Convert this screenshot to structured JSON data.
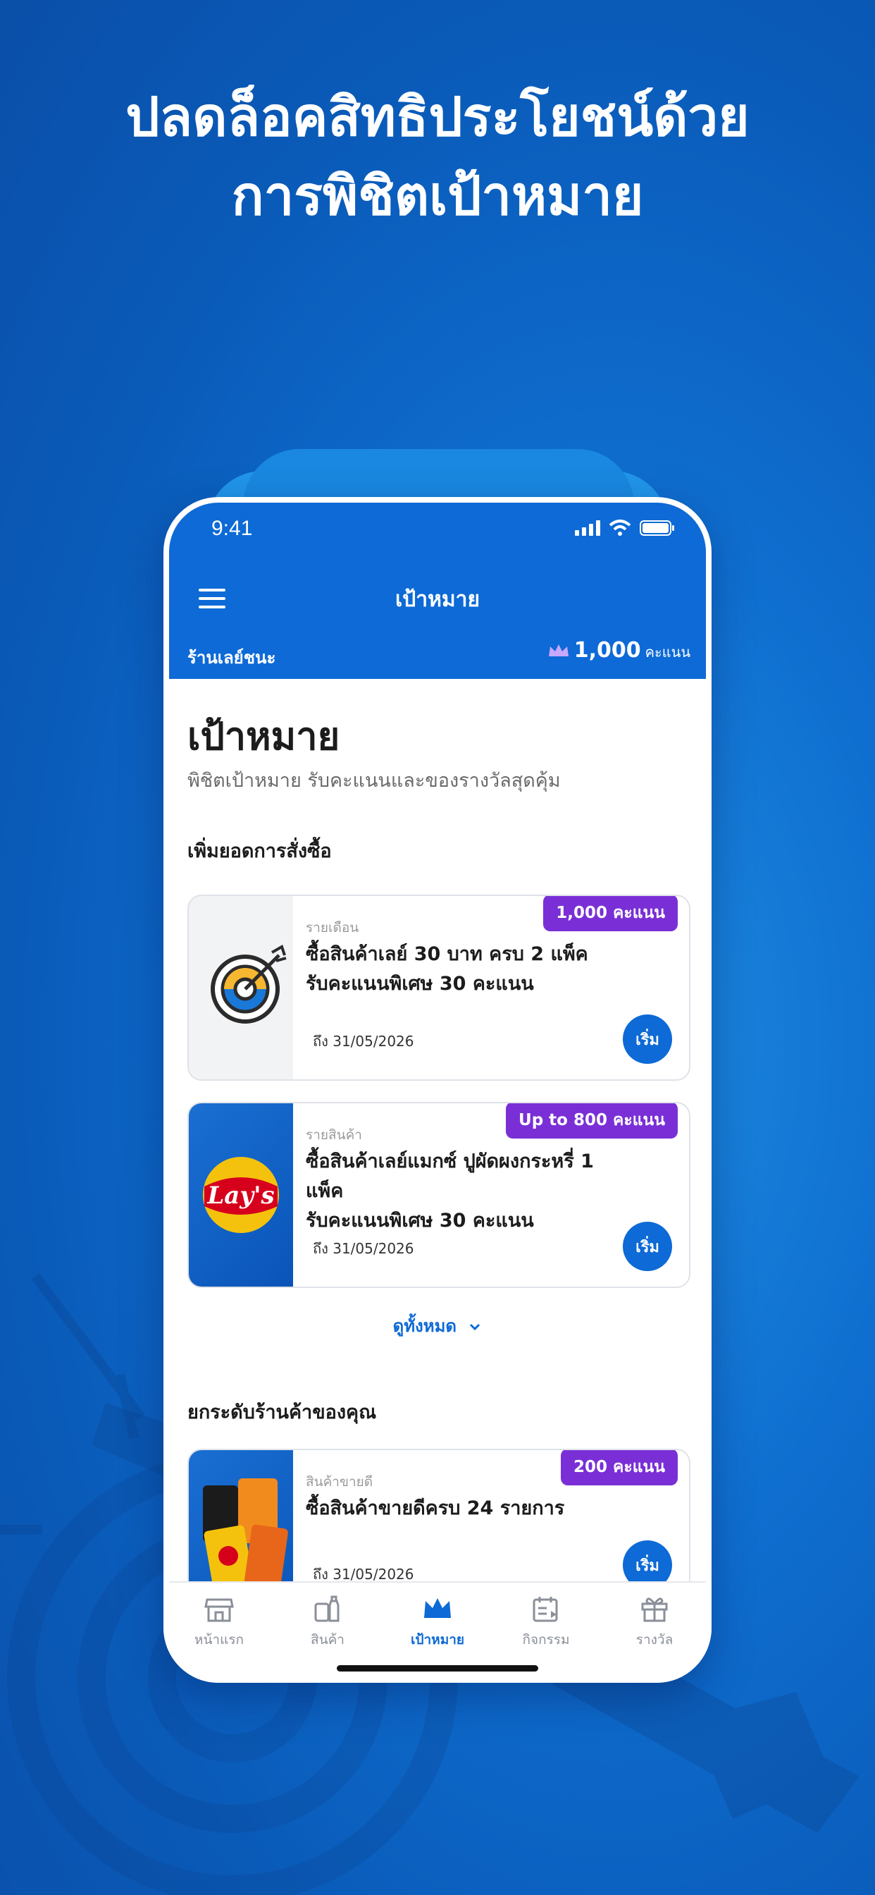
{
  "headline": {
    "line1": "ปลดล็อคสิทธิประโยชน์ด้วย",
    "line2": "การพิชิตเป้าหมาย"
  },
  "status_bar": {
    "time": "9:41"
  },
  "app_bar": {
    "title": "เป้าหมาย",
    "shop_name": "ร้านเลย์ชนะ",
    "points_value": "1,000",
    "points_unit": "คะแนน"
  },
  "page": {
    "title": "เป้าหมาย",
    "subtitle": "พิชิตเป้าหมาย รับคะแนนและของรางวัลสุดคุ้ม"
  },
  "section1": {
    "title": "เพิ่มยอดการสั่งซื้อ",
    "cards": [
      {
        "badge": "1,000 คะแนน",
        "category": "รายเดือน",
        "line1": "ซื้อสินค้าเลย์ 30 บาท ครบ 2 แพ็ค",
        "line2": "รับคะแนนพิเศษ 30 คะแนน",
        "due": "ถึง 31/05/2026",
        "button": "เริ่ม"
      },
      {
        "badge": "Up to 800 คะแนน",
        "category": "รายสินค้า",
        "line1": "ซื้อสินค้าเลย์แมกซ์ ปูผัดผงกระหรี่ 1 แพ็ค",
        "line2": "รับคะแนนพิเศษ 30 คะแนน",
        "due": "ถึง 31/05/2026",
        "button": "เริ่ม"
      }
    ],
    "see_all": "ดูทั้งหมด"
  },
  "section2": {
    "title": "ยกระดับร้านค้าของคุณ",
    "cards": [
      {
        "badge": "200 คะแนน",
        "category": "สินค้าขายดี",
        "line1": "ซื้อสินค้าขายดีครบ 24 รายการ",
        "due": "ถึง 31/05/2026",
        "button": "เริ่ม"
      }
    ]
  },
  "logo_text": "Lay's",
  "tabs": [
    {
      "label": "หน้าแรก",
      "icon": "store-icon"
    },
    {
      "label": "สินค้า",
      "icon": "products-icon"
    },
    {
      "label": "เป้าหมาย",
      "icon": "crown-icon",
      "active": true
    },
    {
      "label": "กิจกรรม",
      "icon": "calendar-icon"
    },
    {
      "label": "รางวัล",
      "icon": "gift-icon"
    }
  ],
  "colors": {
    "primary": "#0d6ad6",
    "badge": "#7a2fd6",
    "background": "#0f6fd0"
  }
}
